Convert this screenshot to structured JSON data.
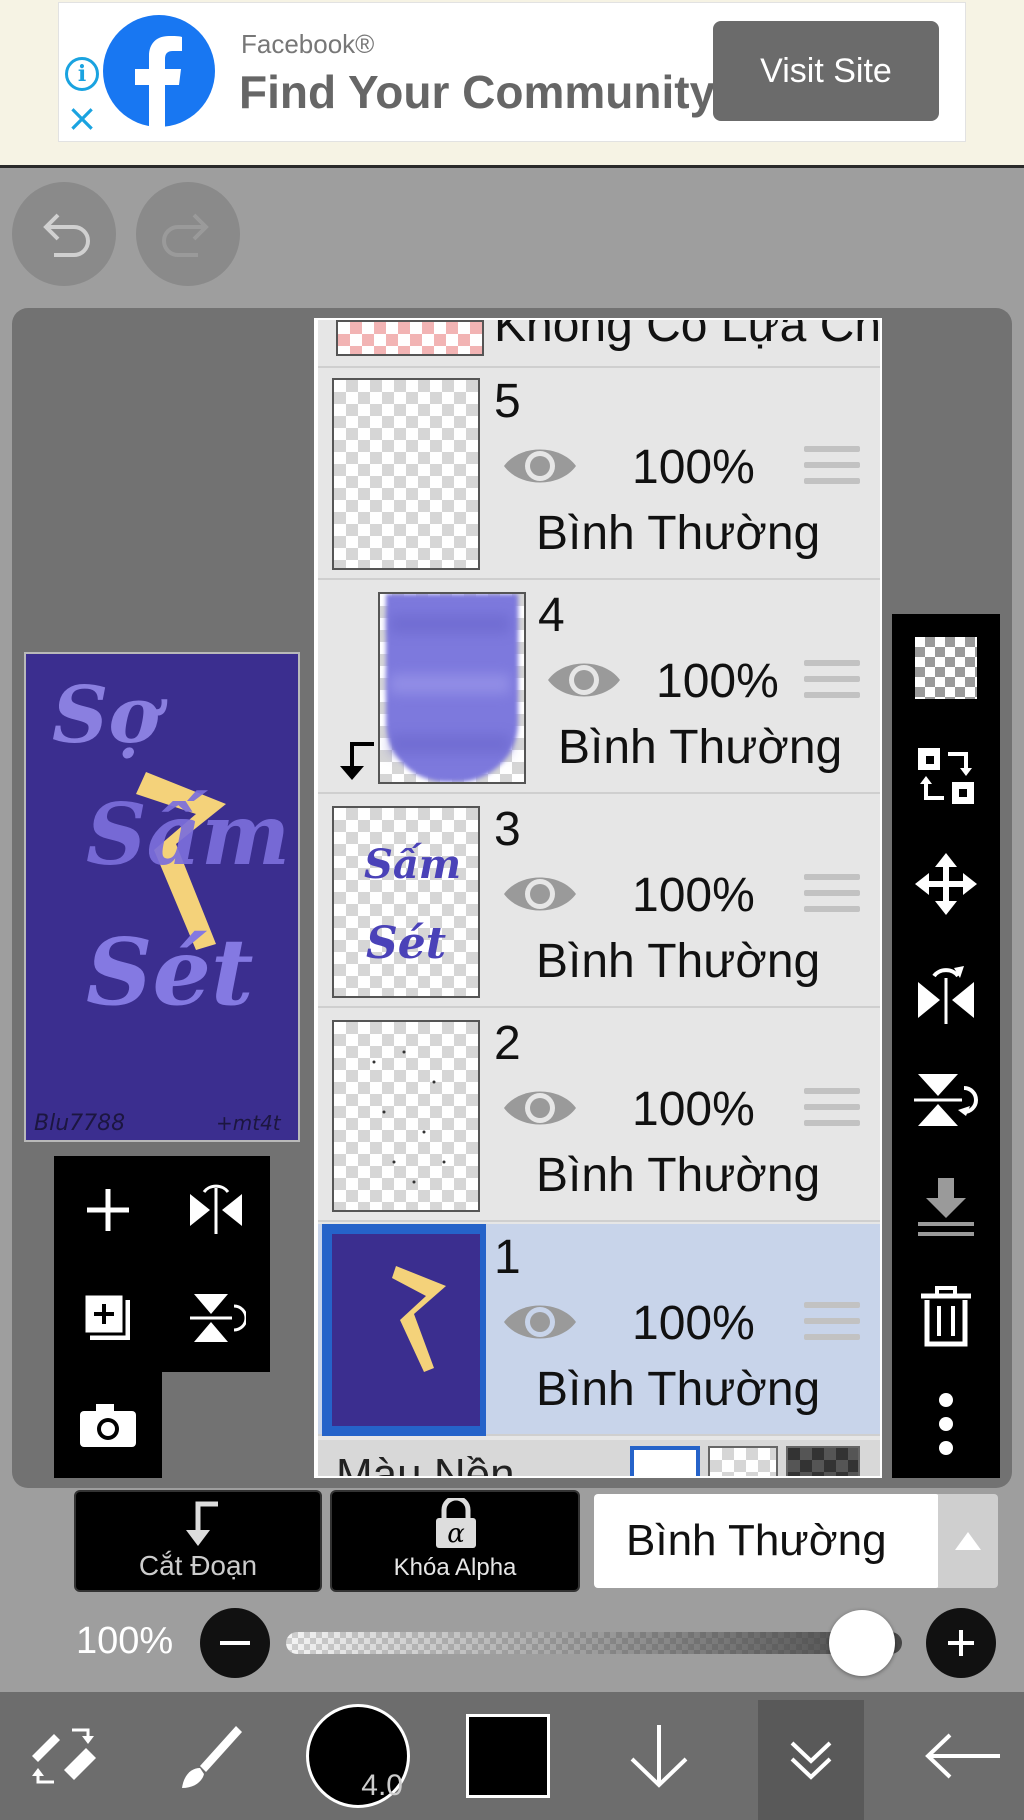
{
  "ad": {
    "brand": "Facebook®",
    "headline": "Find Your Community",
    "cta": "Visit Site",
    "info_icon": "info-icon",
    "close_icon": "close-icon",
    "logo_color": "#1877f2"
  },
  "history": {
    "undo_icon": "undo-icon",
    "redo_icon": "redo-icon"
  },
  "canvas_preview": {
    "art_text": [
      "Sợ",
      "Sấm",
      "Sét"
    ],
    "signature_left": "Blu7788",
    "signature_right": "+mt4t",
    "background_color": "#3b2e8f"
  },
  "layers": {
    "top_partial_label": "Không Có Lựa Chọn",
    "items": [
      {
        "number": "5",
        "opacity": "100%",
        "blend": "Bình Thường",
        "thumbnail": "transparent",
        "visible": true,
        "selected": false,
        "clipped": false
      },
      {
        "number": "4",
        "opacity": "100%",
        "blend": "Bình Thường",
        "thumbnail": "purple-blur",
        "visible": true,
        "selected": false,
        "clipped": true
      },
      {
        "number": "3",
        "opacity": "100%",
        "blend": "Bình Thường",
        "thumbnail": "lettering",
        "visible": true,
        "selected": false,
        "clipped": false
      },
      {
        "number": "2",
        "opacity": "100%",
        "blend": "Bình Thường",
        "thumbnail": "sparse-dots",
        "visible": true,
        "selected": false,
        "clipped": false
      },
      {
        "number": "1",
        "opacity": "100%",
        "blend": "Bình Thường",
        "thumbnail": "purple-lightning",
        "visible": true,
        "selected": true,
        "clipped": false
      }
    ],
    "bottom_partial_label": "Màu Nền",
    "thumb_3_text": [
      "Sấm",
      "Sét"
    ]
  },
  "right_toolbar": [
    "transparency-checker-icon",
    "swap-selection-icon",
    "move-icon",
    "flip-horizontal-icon",
    "flip-vertical-icon",
    "merge-down-icon",
    "trash-icon",
    "more-icon"
  ],
  "layer_tools": [
    "add-layer-icon",
    "flip-layer-h-icon",
    "add-copy-layer-icon",
    "flip-layer-v-icon",
    "camera-icon"
  ],
  "controls": {
    "clipping_label": "Cắt Đoạn",
    "alpha_lock_label": "Khóa Alpha",
    "alpha_lock_glyph": "α",
    "blend_mode": "Bình Thường",
    "opacity_label": "100%",
    "opacity_value": 1.0
  },
  "bottom_bar": {
    "brush_size": "4.0",
    "icons": [
      "transform-tools-icon",
      "brush-icon",
      "brush-size-icon",
      "color-swatch-icon",
      "download-icon",
      "double-chevron-down-icon",
      "back-arrow-icon"
    ],
    "color": "#000000"
  },
  "colors": {
    "selection_blue": "#2563c9",
    "selected_row": "#c8d4ea",
    "panel": "#727272",
    "background": "#9e9e9e"
  }
}
